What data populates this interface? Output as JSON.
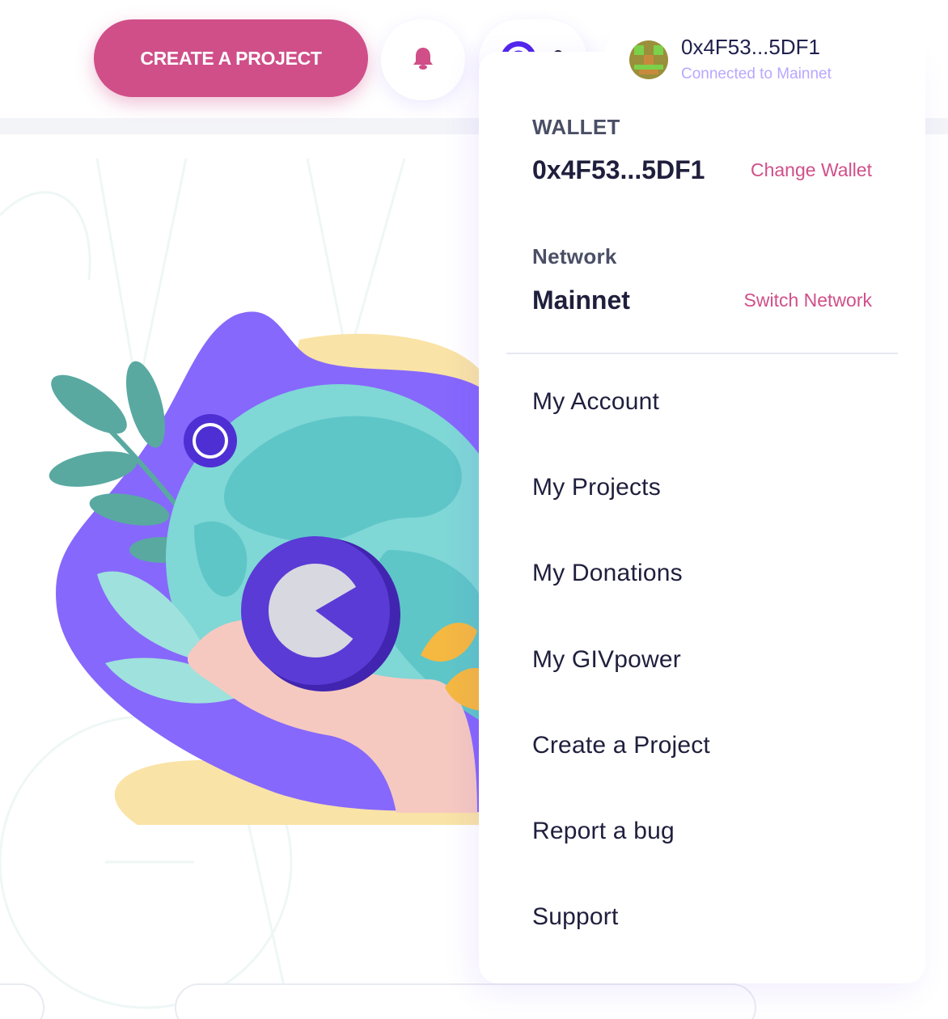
{
  "header": {
    "create_project_label": "CREATE A PROJECT",
    "bell_icon": "bell-icon",
    "network_icon": "giv-network-icon",
    "wallet": {
      "address": "0x4F53...5DF1",
      "status": "Connected to Mainnet"
    }
  },
  "dropdown": {
    "wallet_label": "WALLET",
    "wallet_address": "0x4F53...5DF1",
    "change_wallet": "Change Wallet",
    "network_label": "Network",
    "network_value": "Mainnet",
    "switch_network": "Switch Network",
    "menu": [
      {
        "label": "My Account"
      },
      {
        "label": "My Projects"
      },
      {
        "label": "My Donations"
      },
      {
        "label": "My GIVpower"
      },
      {
        "label": "Create a Project"
      },
      {
        "label": "Report a bug"
      },
      {
        "label": "Support"
      }
    ]
  },
  "colors": {
    "brand_pink": "#d04f89",
    "brand_purple": "#5326ec",
    "text_dark": "#1f1f3d",
    "muted_purple": "#b9a7ff"
  }
}
